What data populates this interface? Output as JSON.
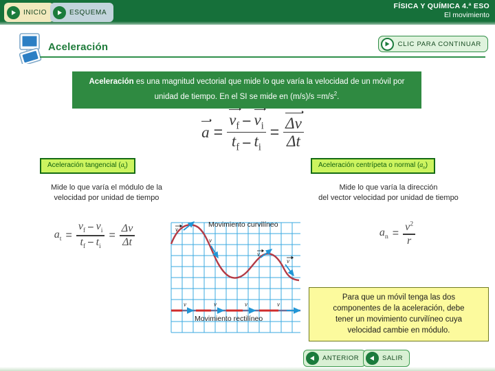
{
  "topbar": {
    "inicio_label": "INICIO",
    "esquema_label": "ESQUEMA",
    "course_line1": "FÍSICA Y QUÍMICA 4.ª ESO",
    "course_line2": "El movimiento"
  },
  "slide": {
    "title": "Aceleración",
    "continue_label": "CLIC PARA CONTINUAR"
  },
  "definition": {
    "term": "Aceleración",
    "text_part1": " es una magnitud vectorial que mide lo que varía la velocidad de un móvil por unidad de tiempo.  En el SI se mide en (m/s)/s =m/s",
    "exponent": "2",
    "text_part2": "."
  },
  "main_formula": {
    "a": "a",
    "eq1": "=",
    "vf": "v",
    "vf_sub": "f",
    "minus1": "−",
    "vi": "v",
    "vi_sub": "i",
    "tf": "t",
    "tf_sub": "f",
    "minus2": "−",
    "ti": "t",
    "ti_sub": "i",
    "eq2": "=",
    "delta_v": "Δv",
    "delta_t": "Δt"
  },
  "tangencial": {
    "label": "Aceleración tangencial (",
    "label_var": "a",
    "label_sub": "t",
    "label_end": ")",
    "description_line1": "Mide lo que varía el módulo de la",
    "description_line2": "velocidad por unidad de tiempo",
    "formula": {
      "a": "a",
      "a_sub": "t",
      "eq1": "=",
      "vf": "v",
      "vf_sub": "f",
      "minus1": "−",
      "vi": "v",
      "vi_sub": "i",
      "tf": "t",
      "tf_sub": "f",
      "minus2": "−",
      "ti": "t",
      "ti_sub": "i",
      "eq2": "=",
      "delta_v": "Δv",
      "delta_t": "Δt"
    }
  },
  "centripeta": {
    "label": "Aceleración centrípeta o normal (",
    "label_var": "a",
    "label_sub": "n",
    "label_end": ")",
    "description_line1": "Mide lo que varía la dirección",
    "description_line2": "del vector velocidad por unidad de tiempo",
    "formula": {
      "a": "a",
      "a_sub": "n",
      "eq": "=",
      "v": "v",
      "v_exp": "2",
      "r": "r"
    }
  },
  "diagram": {
    "label_curvilineo": "Movimiento curvilíneo",
    "label_rectilineo": "Movimiento rectilíneo",
    "vector_label": "v",
    "grid_color": "#3aa8e0",
    "curve_color": "#b33a45",
    "vector_color": "#2196d6"
  },
  "note": {
    "line1": "Para que un móvil tenga las dos",
    "line2": "componentes de la aceleración, debe",
    "line3": "tener un movimiento curvilíneo cuya",
    "line4": "velocidad cambie en módulo."
  },
  "footer": {
    "anterior_label": "ANTERIOR",
    "salir_label": "SALIR"
  },
  "colors": {
    "header_green": "#16703a",
    "box_green": "#2f8a41",
    "label_lime": "#ccf45f",
    "note_yellow": "#fcfa9d"
  }
}
